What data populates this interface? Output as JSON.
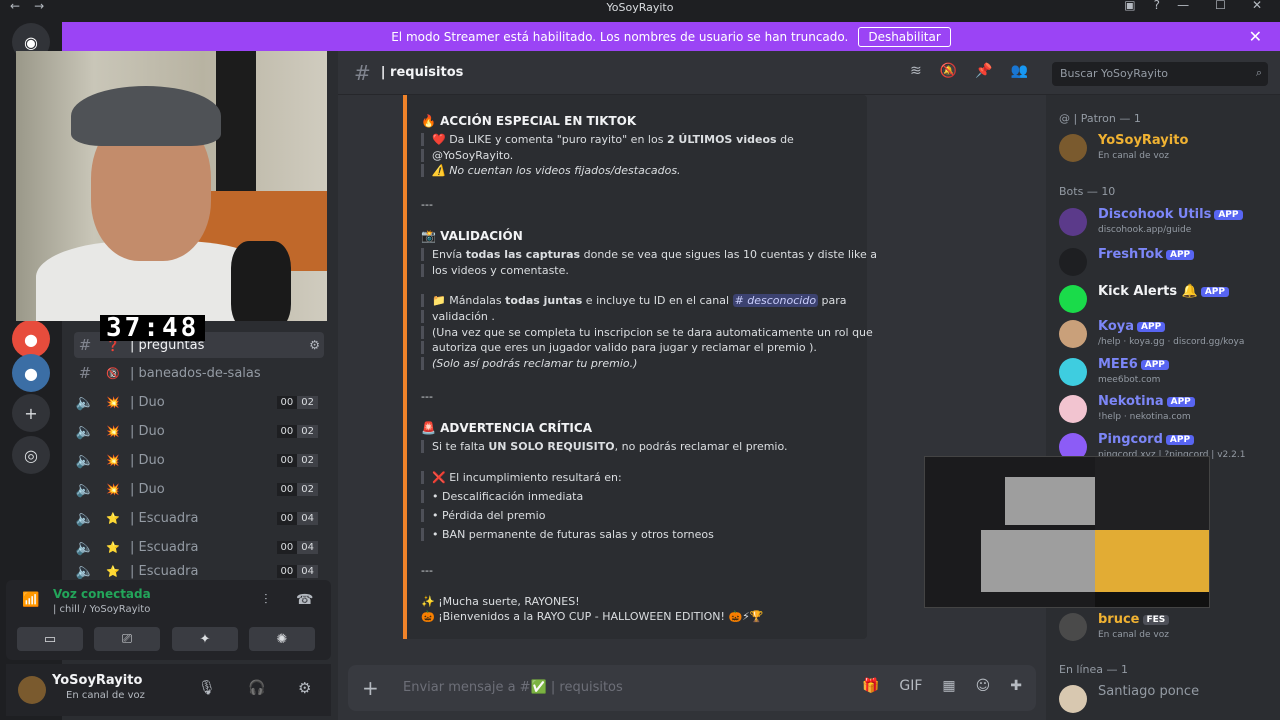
{
  "window": {
    "title": "YoSoyRayito"
  },
  "banner": {
    "text": "El modo Streamer está habilitado. Los nombres de usuario se han truncado.",
    "button": "Deshabilitar"
  },
  "overlay": {
    "timer": "37:48"
  },
  "channels": [
    {
      "emoji": "❓",
      "name": "| preguntas",
      "type": "text"
    },
    {
      "emoji": "🔞",
      "name": "| baneados-de-salas",
      "type": "text"
    },
    {
      "emoji": "💥",
      "name": "| Duo",
      "type": "voice",
      "users": "00",
      "limit": "02"
    },
    {
      "emoji": "💥",
      "name": "| Duo",
      "type": "voice",
      "users": "00",
      "limit": "02"
    },
    {
      "emoji": "💥",
      "name": "| Duo",
      "type": "voice",
      "users": "00",
      "limit": "02"
    },
    {
      "emoji": "💥",
      "name": "| Duo",
      "type": "voice",
      "users": "00",
      "limit": "02"
    },
    {
      "emoji": "⭐",
      "name": "| Escuadra",
      "type": "voice",
      "users": "00",
      "limit": "04"
    },
    {
      "emoji": "⭐",
      "name": "| Escuadra",
      "type": "voice",
      "users": "00",
      "limit": "04"
    },
    {
      "emoji": "⭐",
      "name": "| Escuadra",
      "type": "voice",
      "users": "00",
      "limit": "04"
    }
  ],
  "voice": {
    "status": "Voz conectada",
    "channel": "| chill / YoSoyRayito"
  },
  "user": {
    "name": "YoSoyRayito",
    "status": "En canal de voz"
  },
  "header": {
    "channel": "| requisitos",
    "search_placeholder": "Buscar YoSoyRayito"
  },
  "embed": {
    "s1_title": "ACCIÓN ESPECIAL EN TIKTOK",
    "s1_l1a": "Da LIKE y comenta \"puro rayito\" en los ",
    "s1_l1b": "2 ÚLTIMOS videos",
    "s1_l1c": " de",
    "s1_l2": "@YoSoyRayito.",
    "s1_l3": "No cuentan los videos fijados/destacados.",
    "sep": "---",
    "s2_title": "VALIDACIÓN",
    "s2_l1a": "Envía ",
    "s2_l1b": "todas las capturas",
    "s2_l1c": " donde se vea que sigues las 10 cuentas y diste like a",
    "s2_l2": "los videos y comentaste.",
    "s2_l3a": "Mándalas ",
    "s2_l3b": "todas juntas",
    "s2_l3c": " e incluye tu ID en el canal ",
    "s2_mention": "# desconocido",
    "s2_l3d": " para",
    "s2_l4": "validación .",
    "s2_l5": "(Una vez que se completa tu inscripcion se te dara automaticamente un rol que",
    "s2_l6": "autoriza que eres un jugador valido para jugar y reclamar el premio ).",
    "s2_l7": "(Solo así podrás reclamar tu premio.)",
    "s3_title": "ADVERTENCIA CRÍTICA",
    "s3_l1a": "Si te falta ",
    "s3_l1b": "UN SOLO REQUISITO",
    "s3_l1c": ", no podrás reclamar el premio.",
    "s3_l2": "El incumplimiento resultará en:",
    "s3_b1": "Descalificación inmediata",
    "s3_b2": "Pérdida del premio",
    "s3_b3": "BAN permanente de futuras salas y otros torneos",
    "end1": "¡Mucha suerte, RAYONES!",
    "end2": "¡Bienvenidos a la RAYO CUP - HALLOWEEN EDITION!"
  },
  "composer": {
    "placeholder": "Enviar mensaje a #",
    "channel": "| requisitos"
  },
  "members": {
    "patron_header": "@ | Patron — 1",
    "bots_header": "Bots — 10",
    "online_header": "En línea — 1",
    "list": [
      {
        "name": "YoSoyRayito",
        "sub": "En canal de voz",
        "color": "#f0b232",
        "tag": ""
      },
      {
        "name": "Discohook Utils",
        "sub": "discohook.app/guide",
        "color": "#7c86f7",
        "tag": "APP"
      },
      {
        "name": "FreshTok",
        "sub": "",
        "color": "#7c86f7",
        "tag": "APP"
      },
      {
        "name": "Kick Alerts 🔔",
        "sub": "",
        "color": "#f2f3f5",
        "tag": "APP"
      },
      {
        "name": "Koya",
        "sub": "/help · koya.gg · discord.gg/koya",
        "color": "#7c86f7",
        "tag": "APP"
      },
      {
        "name": "MEE6",
        "sub": "mee6bot.com",
        "color": "#7c86f7",
        "tag": "APP"
      },
      {
        "name": "Nekotina",
        "sub": "!help · nekotina.com",
        "color": "#7c86f7",
        "tag": "APP"
      },
      {
        "name": "Pingcord",
        "sub": "pingcord.xyz | ?pingcord | v2.2.1",
        "color": "#7c86f7",
        "tag": "APP"
      },
      {
        "name": "bruce",
        "sub": "En canal de voz",
        "color": "#f0b232",
        "tag": "FES"
      },
      {
        "name": "Santiago ponce",
        "sub": "",
        "color": "#949ba4",
        "tag": ""
      }
    ]
  }
}
